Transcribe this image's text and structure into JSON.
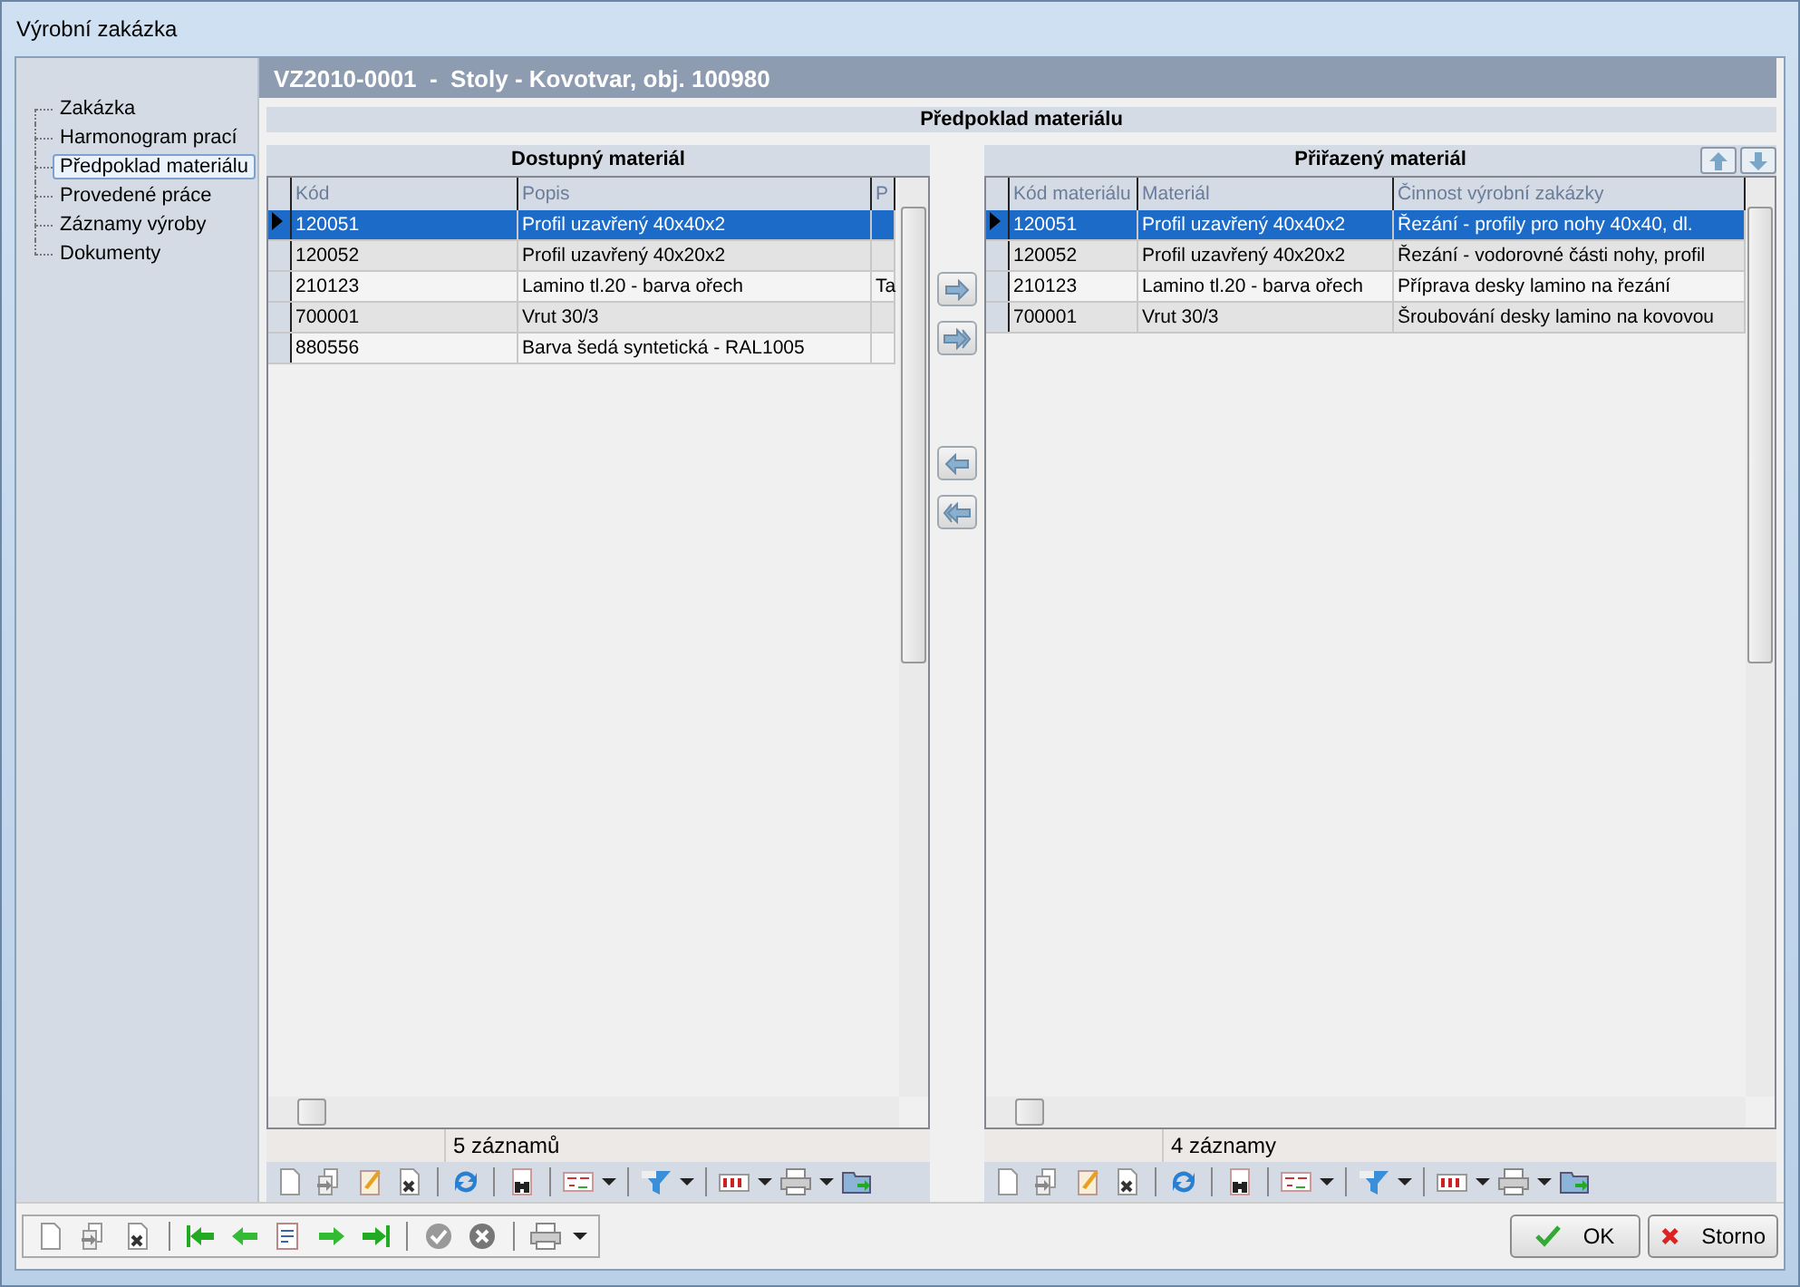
{
  "window": {
    "title": "Výrobní zakázka"
  },
  "sidebar": {
    "items": [
      {
        "label": "Zakázka",
        "selected": false
      },
      {
        "label": "Harmonogram prací",
        "selected": false
      },
      {
        "label": "Předpoklad materiálu",
        "selected": true
      },
      {
        "label": "Provedené práce",
        "selected": false
      },
      {
        "label": "Záznamy výroby",
        "selected": false
      },
      {
        "label": "Dokumenty",
        "selected": false
      }
    ]
  },
  "header": {
    "title": "VZ2010-0001  -  Stoly - Kovotvar, obj. 100980"
  },
  "section": {
    "title": "Předpoklad materiálu"
  },
  "available": {
    "title": "Dostupný materiál",
    "columns": [
      "Kód",
      "Popis",
      "P"
    ],
    "rows": [
      {
        "cells": [
          "120051",
          "Profil uzavřený 40x40x2"
        ],
        "selected": true
      },
      {
        "cells": [
          "120052",
          "Profil uzavřený 40x20x2"
        ],
        "selected": false
      },
      {
        "cells": [
          "210123",
          "Lamino tl.20 - barva ořech",
          "Ta"
        ],
        "selected": false
      },
      {
        "cells": [
          "700001",
          "Vrut 30/3"
        ],
        "selected": false
      },
      {
        "cells": [
          "880556",
          "Barva šedá syntetická - RAL1005"
        ],
        "selected": false
      }
    ],
    "status": "5 záznamů"
  },
  "assigned": {
    "title": "Přiřazený materiál",
    "columns": [
      "Kód materiálu",
      "Materiál",
      "Činnost výrobní zakázky"
    ],
    "rows": [
      {
        "cells": [
          "120051",
          "Profil uzavřený 40x40x2",
          "Řezání - profily pro nohy 40x40, dl."
        ],
        "selected": true
      },
      {
        "cells": [
          "120052",
          "Profil uzavřený 40x20x2",
          "Řezání - vodorovné části nohy, profil"
        ],
        "selected": false
      },
      {
        "cells": [
          "210123",
          "Lamino tl.20 - barva ořech",
          "Příprava desky lamino na řezání"
        ],
        "selected": false
      },
      {
        "cells": [
          "700001",
          "Vrut 30/3",
          "Šroubování desky lamino na kovovou"
        ],
        "selected": false
      }
    ],
    "status": "4 záznamy"
  },
  "buttons": [
    {
      "label": "OK",
      "kind": "ok"
    },
    {
      "label": "Storno",
      "kind": "cancel"
    }
  ]
}
